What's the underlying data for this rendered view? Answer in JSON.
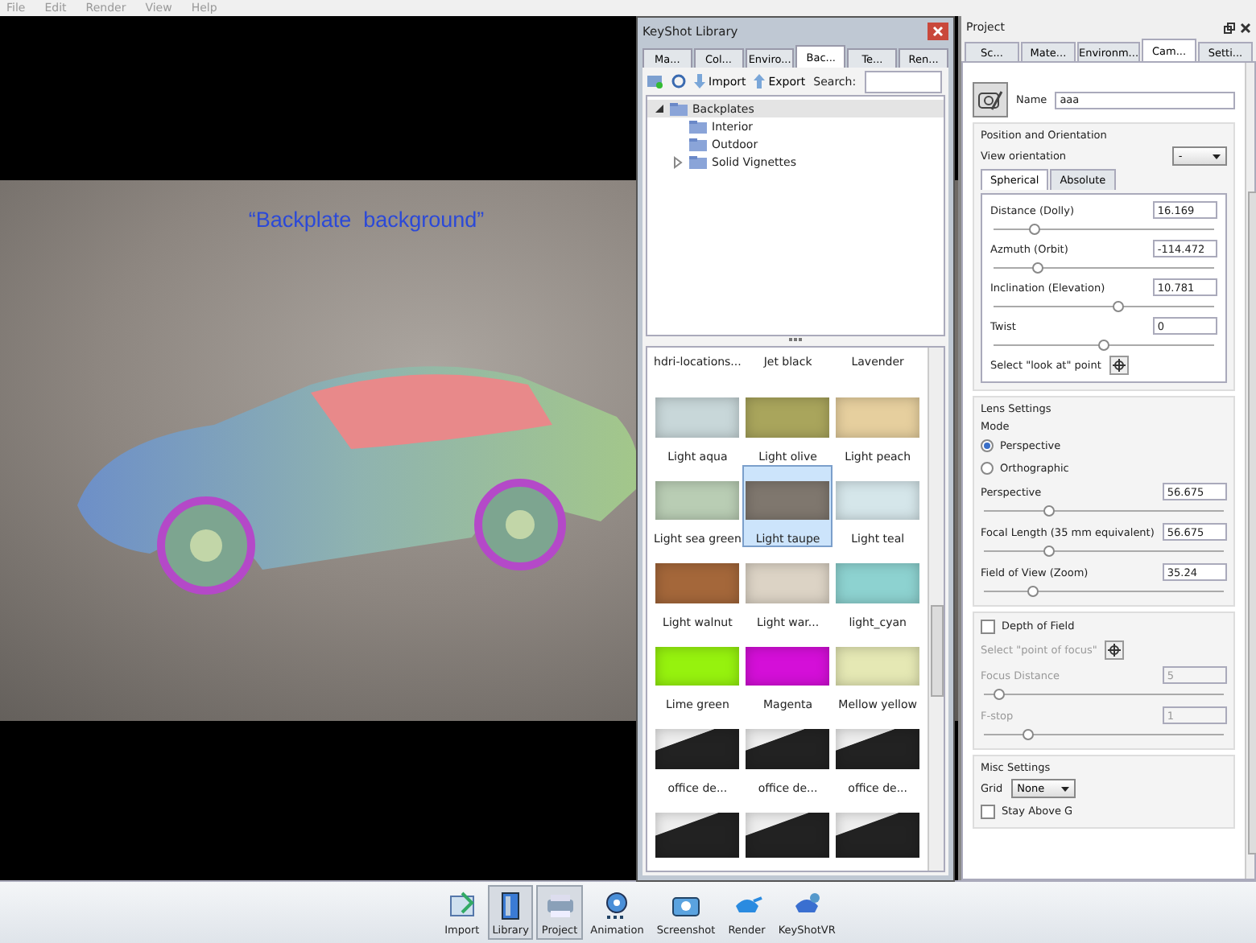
{
  "menu": [
    {
      "label": "File"
    },
    {
      "label": "Edit"
    },
    {
      "label": "Render"
    },
    {
      "label": "View"
    },
    {
      "label": "Help"
    }
  ],
  "viewport": {
    "caption": "“Backplate  background”"
  },
  "library": {
    "title": "KeyShot Library",
    "tabs": [
      {
        "label": "Ma...",
        "selected": false
      },
      {
        "label": "Col...",
        "selected": false
      },
      {
        "label": "Enviro...",
        "selected": false
      },
      {
        "label": "Bac...",
        "selected": true
      },
      {
        "label": "Te...",
        "selected": false
      },
      {
        "label": "Ren...",
        "selected": false
      }
    ],
    "toolbar": {
      "import": "Import",
      "export": "Export",
      "search_label": "Search:"
    },
    "tree": [
      {
        "label": "Backplates",
        "expanded": true,
        "selected": true,
        "children": [
          {
            "label": "Interior",
            "selected": false
          },
          {
            "label": "Outdoor",
            "selected": false
          },
          {
            "label": "Solid Vignettes",
            "expanded": false,
            "selected": false
          }
        ]
      }
    ],
    "items": [
      {
        "label": "hdri-locations...",
        "kind": "label",
        "selected": false
      },
      {
        "label": "Jet black",
        "kind": "label",
        "selected": false
      },
      {
        "label": "Lavender",
        "kind": "label",
        "selected": false
      },
      {
        "label": "Light aqua",
        "kind": "swatch",
        "color": "#c8d7d9",
        "selected": false
      },
      {
        "label": "Light olive",
        "kind": "swatch",
        "color": "#a9a55c",
        "selected": false
      },
      {
        "label": "Light peach",
        "kind": "swatch",
        "color": "#e6cf9e",
        "selected": false
      },
      {
        "label": "Light sea green",
        "kind": "swatch",
        "color": "#b9cdb4",
        "selected": false
      },
      {
        "label": "Light taupe",
        "kind": "swatch",
        "color": "#7f776e",
        "selected": true
      },
      {
        "label": "Light teal",
        "kind": "swatch",
        "color": "#d5e6ea",
        "selected": false
      },
      {
        "label": "Light walnut",
        "kind": "swatch",
        "color": "#a4673a",
        "selected": false
      },
      {
        "label": "Light war...",
        "kind": "swatch",
        "color": "#dcd3c5",
        "selected": false
      },
      {
        "label": "light_cyan",
        "kind": "swatch",
        "color": "#8dd2d0",
        "selected": false
      },
      {
        "label": "Lime green",
        "kind": "swatch",
        "color": "#96f20e",
        "selected": false
      },
      {
        "label": "Magenta",
        "kind": "swatch",
        "color": "#d40fd8",
        "selected": false
      },
      {
        "label": "Mellow yellow",
        "kind": "swatch",
        "color": "#e5e8b4",
        "selected": false
      },
      {
        "label": "office de...",
        "kind": "photo",
        "selected": false
      },
      {
        "label": "office de...",
        "kind": "photo",
        "selected": false
      },
      {
        "label": "office de...",
        "kind": "photo",
        "selected": false
      },
      {
        "kind": "photo",
        "selected": false
      },
      {
        "kind": "photo",
        "selected": false
      },
      {
        "kind": "photo",
        "selected": false
      }
    ]
  },
  "project": {
    "title": "Project",
    "tabs": [
      {
        "label": "Sc...",
        "selected": false
      },
      {
        "label": "Mate...",
        "selected": false
      },
      {
        "label": "Environm...",
        "selected": false
      },
      {
        "label": "Cam...",
        "selected": true
      },
      {
        "label": "Setti...",
        "selected": false
      }
    ],
    "name_label": "Name",
    "name_value": "aaa",
    "position": {
      "title": "Position and Orientation",
      "view_label": "View orientation",
      "view_value": "-",
      "subtabs": [
        {
          "label": "Spherical",
          "selected": true
        },
        {
          "label": "Absolute",
          "selected": false
        }
      ],
      "sliders": [
        {
          "label": "Distance (Dolly)",
          "value": "16.169",
          "level": 0.18
        },
        {
          "label": "Azmuth (Orbit)",
          "value": "-114.472",
          "level": 0.2
        },
        {
          "label": "Inclination (Elevation)",
          "value": "10.781",
          "level": 0.56
        },
        {
          "label": "Twist",
          "value": "0",
          "level": 0.5
        }
      ],
      "look_at": "Select \"look at\" point"
    },
    "lens": {
      "title": "Lens Settings",
      "mode_label": "Mode",
      "modes": [
        {
          "label": "Perspective",
          "selected": true
        },
        {
          "label": "Orthographic",
          "selected": false
        }
      ],
      "sliders": [
        {
          "label": "Perspective",
          "value": "56.675",
          "level": 0.27
        },
        {
          "label": "Focal Length (35 mm equivalent)",
          "value": "56.675",
          "level": 0.27
        },
        {
          "label": "Field of View (Zoom)",
          "value": "35.24",
          "level": 0.2
        }
      ]
    },
    "dof": {
      "label": "Depth of Field",
      "checked": false,
      "focus": "Select \"point of focus\"",
      "sliders": [
        {
          "label": "Focus Distance",
          "value": "5",
          "level": 0.06,
          "disabled": true
        },
        {
          "label": "F-stop",
          "value": "1",
          "level": 0.18,
          "disabled": true
        }
      ]
    },
    "misc": {
      "title": "Misc Settings",
      "grid_label": "Grid",
      "grid_value": "None",
      "stay": {
        "label": "Stay Above G",
        "checked": false
      }
    }
  },
  "toolbar": [
    {
      "label": "Import",
      "selected": false
    },
    {
      "label": "Library",
      "selected": true
    },
    {
      "label": "Project",
      "selected": true
    },
    {
      "label": "Animation",
      "selected": false
    },
    {
      "label": "Screenshot",
      "selected": false
    },
    {
      "label": "Render",
      "selected": false
    },
    {
      "label": "KeyShotVR",
      "selected": false
    }
  ]
}
